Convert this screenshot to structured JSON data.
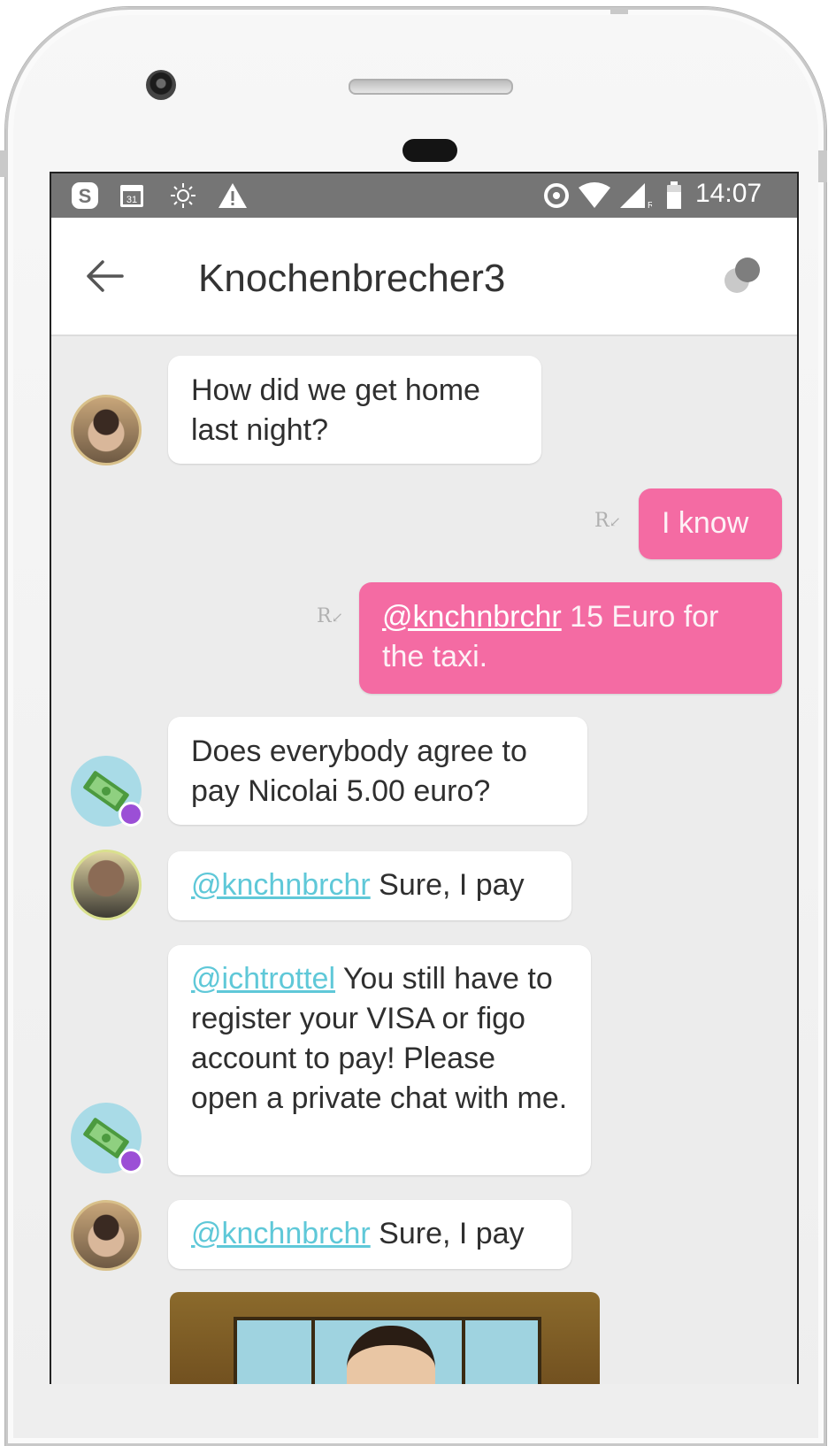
{
  "status_bar": {
    "time": "14:07",
    "left_icons": [
      "skype-icon",
      "calendar-icon",
      "brightness-icon",
      "warning-icon"
    ],
    "calendar_day": "31",
    "right_icons": [
      "data-saver-icon",
      "wifi-icon",
      "cell-signal-icon",
      "battery-icon"
    ]
  },
  "app_bar": {
    "title": "Knochenbrecher3",
    "back_icon": "arrow-left-icon",
    "menu_icon": "settings-dots-icon"
  },
  "messages": [
    {
      "direction": "in",
      "avatar": "person-avatar",
      "mention": "",
      "text": "How did we get home\nlast night?"
    },
    {
      "direction": "out",
      "receipt": "R",
      "mention": "",
      "text": "I know"
    },
    {
      "direction": "out",
      "receipt": "R",
      "mention": "@knchnbrchr",
      "text": " 15 Euro for the taxi."
    },
    {
      "direction": "in",
      "avatar": "bot-avatar",
      "mention": "",
      "text": "Does everybody agree to\npay Nicolai 5.00 euro?"
    },
    {
      "direction": "in",
      "avatar": "man-avatar",
      "mention": "@knchnbrchr",
      "text": " Sure, I pay"
    },
    {
      "direction": "in",
      "avatar": "bot-avatar",
      "mention": "@ichtrottel",
      "text": " You still have to register your VISA or figo account to pay! Please open a private chat with me."
    },
    {
      "direction": "in",
      "avatar": "person-avatar",
      "mention": "@knchnbrchr",
      "text": " Sure, I pay"
    },
    {
      "direction": "in",
      "avatar": "person-avatar",
      "attachment": "gif-image"
    }
  ],
  "colors": {
    "outgoing_bubble": "#f46ba3",
    "incoming_bubble": "#ffffff",
    "background": "#ececec",
    "status_bar": "#757575",
    "mention": "#5fc8d8"
  }
}
